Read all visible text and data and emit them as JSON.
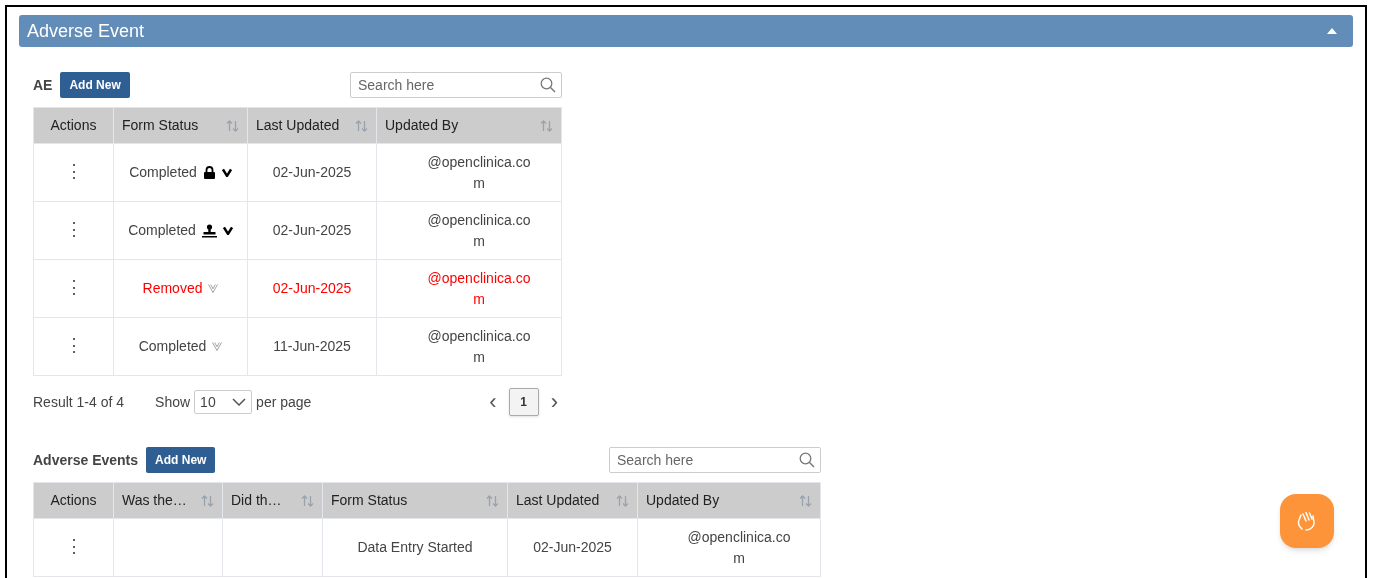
{
  "panel": {
    "title": "Adverse Event",
    "expanded": true
  },
  "tables": [
    {
      "label": "AE",
      "add_button": "Add New",
      "search": {
        "placeholder": "Search here"
      },
      "columns": [
        {
          "label": "Actions",
          "sortable": false
        },
        {
          "label": "Form Status",
          "sortable": true
        },
        {
          "label": "Last Updated",
          "sortable": true
        },
        {
          "label": "Updated By",
          "sortable": true
        }
      ],
      "rows": [
        {
          "removed": false,
          "cells": [
            "⋮",
            {
              "status": "Completed",
              "kind": "locked"
            },
            "02-Jun-2025",
            "@openclinica.com"
          ]
        },
        {
          "removed": false,
          "cells": [
            "⋮",
            {
              "status": "Completed",
              "kind": "signed"
            },
            "02-Jun-2025",
            "@openclinica.com"
          ]
        },
        {
          "removed": true,
          "cells": [
            "⋮",
            {
              "status": "Removed",
              "kind": "plain"
            },
            "02-Jun-2025",
            "@openclinica.com"
          ]
        },
        {
          "removed": false,
          "cells": [
            "⋮",
            {
              "status": "Completed",
              "kind": "plain"
            },
            "11-Jun-2025",
            "@openclinica.com"
          ]
        }
      ],
      "footer": {
        "result": "Result 1-4 of 4",
        "show": "Show",
        "page_size": "10",
        "per_page": "per page",
        "prev": "‹",
        "pages": [
          {
            "label": "1",
            "selected": true
          }
        ],
        "next": "›"
      }
    },
    {
      "label": "Adverse Events",
      "add_button": "Add New",
      "search": {
        "placeholder": "Search here"
      },
      "columns": [
        {
          "label": "Actions",
          "sortable": false
        },
        {
          "label": "Was the…",
          "sortable": true
        },
        {
          "label": "Did th…",
          "sortable": true
        },
        {
          "label": "Form Status",
          "sortable": true
        },
        {
          "label": "Last Updated",
          "sortable": true
        },
        {
          "label": "Updated By",
          "sortable": true
        }
      ],
      "rows": [
        {
          "removed": false,
          "cells": [
            "⋮",
            "",
            "",
            {
              "status": "Data Entry Started",
              "kind": "started"
            },
            "02-Jun-2025",
            "@openclinica.com"
          ]
        }
      ]
    }
  ]
}
